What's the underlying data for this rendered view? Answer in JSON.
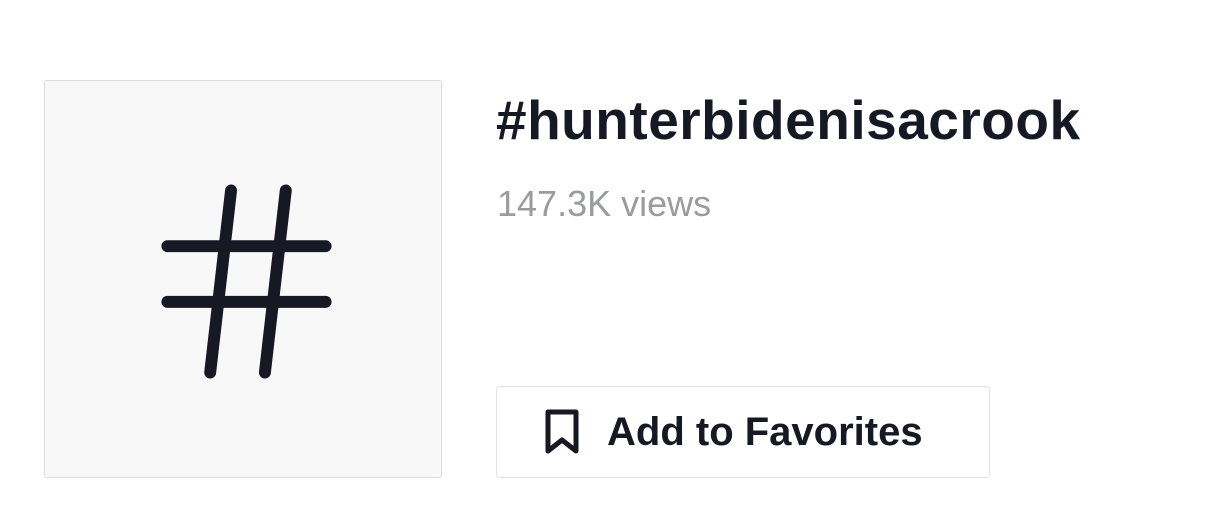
{
  "hashtag": {
    "cover_icon": "hashtag-icon",
    "title": "#hunterbidenisacrook",
    "views_count": "147.3K",
    "views_label": "views"
  },
  "actions": {
    "favorites_label": "Add to Favorites",
    "favorites_icon": "bookmark-icon"
  },
  "colors": {
    "text_primary": "#161823",
    "text_secondary": "#9a9ba0",
    "card_background": "#f8f8f8",
    "border": "#e3e3e4"
  }
}
